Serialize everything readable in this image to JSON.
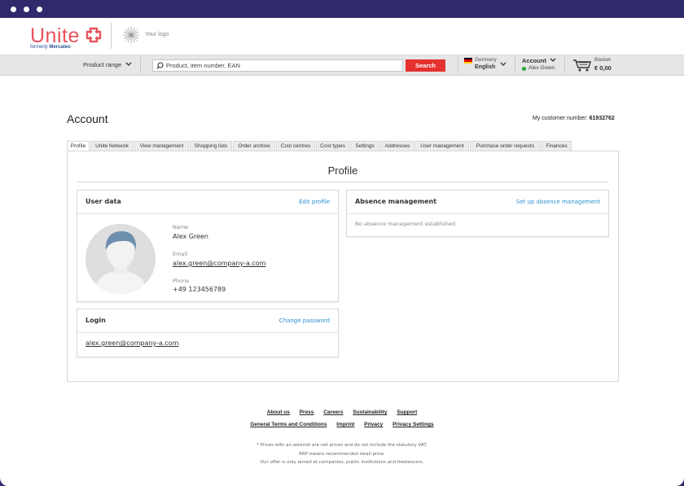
{
  "brand": {
    "name": "Unite",
    "formerly": "formerly",
    "formerly_name": "Mercateo",
    "your_logo": "Your logo",
    "accent": "#e9525b"
  },
  "navbar": {
    "product_range": "Product range",
    "search_placeholder": "Product, item number, EAN",
    "search_button": "Search",
    "country": "Germany",
    "language": "English",
    "account_label": "Account",
    "account_user": "Alex Green",
    "basket_label": "Basket",
    "basket_amount": "€ 0,00"
  },
  "page": {
    "title": "Account",
    "customer_number_label": "My customer number:",
    "customer_number": "61932762"
  },
  "tabs": [
    {
      "label": "Profile",
      "active": true
    },
    {
      "label": "Unite Network"
    },
    {
      "label": "View management"
    },
    {
      "label": "Shopping lists"
    },
    {
      "label": "Order archive"
    },
    {
      "label": "Cost centres"
    },
    {
      "label": "Cost types"
    },
    {
      "label": "Settings"
    },
    {
      "label": "Addresses"
    },
    {
      "label": "User management"
    },
    {
      "label": "Purchase order requests"
    },
    {
      "label": "Finances"
    }
  ],
  "profile": {
    "heading": "Profile",
    "user_data": {
      "title": "User data",
      "edit_link": "Edit profile",
      "name_label": "Name",
      "name": "Alex Green",
      "email_label": "Email",
      "email": "alex.green@company-a.com",
      "phone_label": "Phone",
      "phone": "+49 123456789"
    },
    "login": {
      "title": "Login",
      "change_link": "Change password",
      "login_email": "alex.green@company-a.com"
    },
    "absence": {
      "title": "Absence management",
      "setup_link": "Set up absence management",
      "empty_text": "No absence management established."
    }
  },
  "footer": {
    "links_row1": [
      "About us",
      "Press",
      "Careers",
      "Sustainability",
      "Support"
    ],
    "links_row2": [
      "General Terms and Conditions",
      "Imprint",
      "Privacy",
      "Privacy Settings"
    ],
    "note1": "* Prices with an asterisk are net prices and do not include the statutory VAT.",
    "note2": "RRP means recommended retail price.",
    "note3": "Our offer is only aimed at companies, public institutions and freelancers."
  },
  "colors": {
    "link": "#2b8fd1",
    "search_button": "#e53130",
    "frame": "#2f2a6b",
    "online": "#2aa63a"
  }
}
